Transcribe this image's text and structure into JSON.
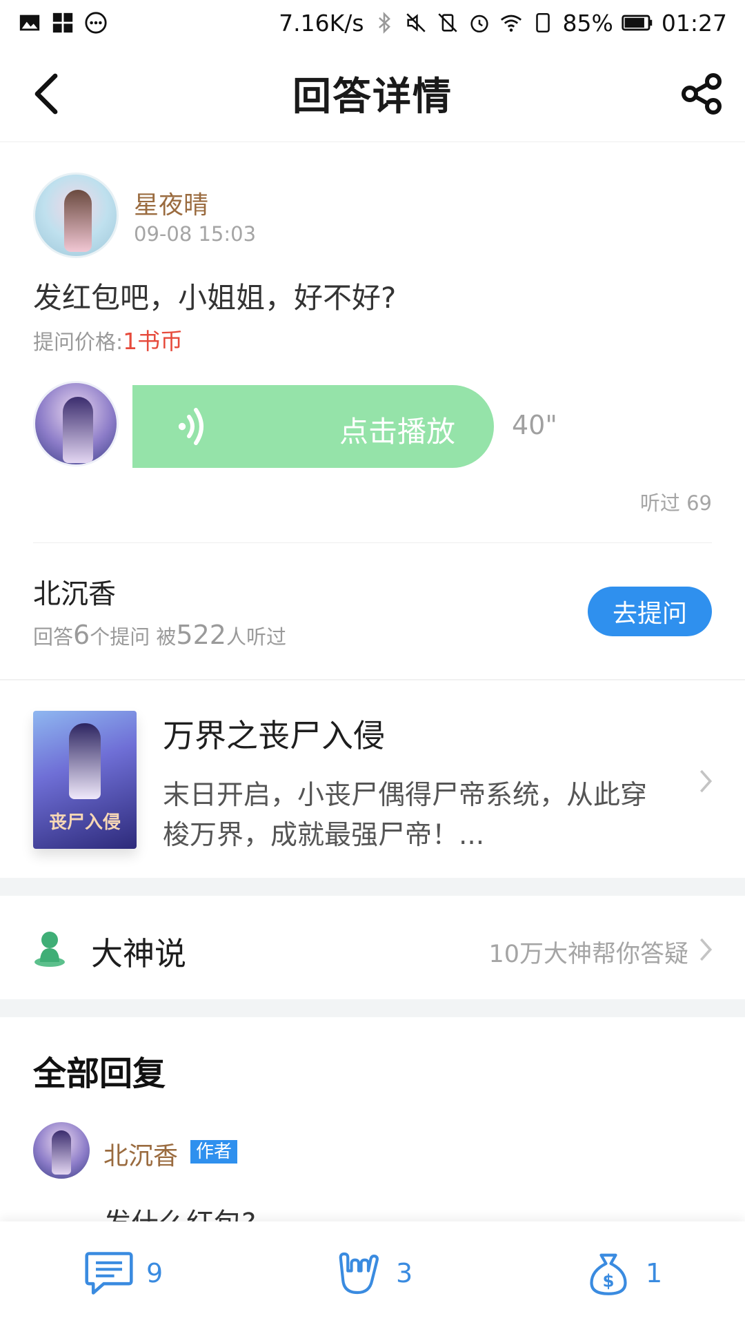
{
  "status_bar": {
    "speed": "7.16K/s",
    "battery": "85%",
    "time": "01:27"
  },
  "header": {
    "title": "回答详情"
  },
  "question": {
    "user_name": "星夜晴",
    "time": "09-08 15:03",
    "text": "发红包吧，小姐姐，好不好?",
    "price_label": "提问价格:",
    "price_value": "1书币"
  },
  "answer": {
    "play_label": "点击播放",
    "duration": "40\"",
    "listened": "听过 69"
  },
  "answerer": {
    "name": "北沉香",
    "stats_prefix": "回答",
    "answers_count": "6",
    "stats_mid": "个提问  被",
    "listeners_count": "522",
    "stats_suffix": "人听过",
    "ask_button": "去提问"
  },
  "book": {
    "title": "万界之丧尸入侵",
    "description": "末日开启，小丧尸偶得尸帝系统，从此穿梭万界，成就最强尸帝！...",
    "cover_text": "丧尸入侵"
  },
  "dashen": {
    "title": "大神说",
    "subtitle": "10万大神帮你答疑"
  },
  "replies": {
    "section_title": "全部回复",
    "items": [
      {
        "name": "北沉香",
        "badge": "作者",
        "text": "发什么红包?"
      }
    ]
  },
  "bottom_bar": {
    "comments": "9",
    "likes": "3",
    "rewards": "1"
  },
  "colors": {
    "accent_blue": "#2f90ee",
    "play_green": "#95e3a9",
    "price_red": "#e64a3b",
    "name_brown": "#9a6b3f"
  }
}
